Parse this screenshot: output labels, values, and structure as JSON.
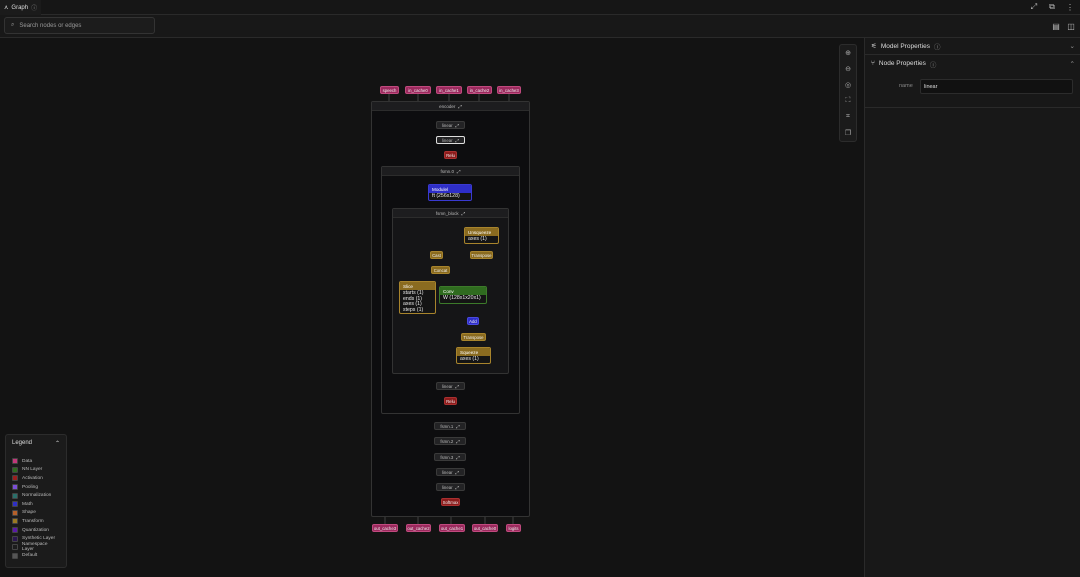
{
  "app": {
    "tab_label": "Graph",
    "search_placeholder": "Search nodes or edges"
  },
  "graph": {
    "inputs": [
      "speech",
      "in_cache0",
      "in_cache1",
      "in_cache2",
      "in_cache3"
    ],
    "outputs": [
      "out_cache3",
      "out_cache2",
      "out_cache1",
      "out_cache0",
      "logits"
    ],
    "encoder": "encoder",
    "linear": "linear",
    "relu": "Relu",
    "fsmn0": "fsmn.0",
    "modulel": {
      "title": "Modulel",
      "attr": "ft (256x128)"
    },
    "fsmn_block": "fsmn_block",
    "unsqueeze": {
      "title": "Unsqueeze",
      "attr": "axes (1)"
    },
    "cast": "Cast",
    "transpose": "Transpose",
    "concat": "Concat",
    "slice": {
      "title": "Slice",
      "attrs": [
        "starts (1)",
        "ends (1)",
        "axes (1)",
        "steps (1)"
      ]
    },
    "conv": {
      "title": "Conv",
      "attr": "W (128x1x20x1)"
    },
    "add": "Add",
    "squeeze": {
      "title": "Squeeze",
      "attr": "axes (1)"
    },
    "fsmn1": "fsmn.1",
    "fsmn2": "fsmn.2",
    "fsmn3": "fsmn.3",
    "softmax": "Softmax"
  },
  "panel": {
    "model_properties": "Model Properties",
    "node_properties": "Node Properties",
    "name_label": "name",
    "name_value": "linear"
  },
  "legend": {
    "title": "Legend",
    "items": [
      {
        "label": "Data",
        "color": "#c2377a"
      },
      {
        "label": "NN Layer",
        "color": "#2f6b1f"
      },
      {
        "label": "Activation",
        "color": "#9a1f1f"
      },
      {
        "label": "Pooling",
        "color": "#7b4fd6"
      },
      {
        "label": "Normalization",
        "color": "#2a6f6a"
      },
      {
        "label": "Math",
        "color": "#2f2fc4"
      },
      {
        "label": "Shape",
        "color": "#b4602a"
      },
      {
        "label": "Transform",
        "color": "#9a7a22"
      },
      {
        "label": "Quantization",
        "color": "#5a1aa8"
      },
      {
        "label": "Synthetic Layer",
        "color": "#2a1650"
      },
      {
        "label": "Namespace Layer",
        "color": "#1c1c1c"
      },
      {
        "label": "Default",
        "color": "#555555"
      }
    ]
  }
}
